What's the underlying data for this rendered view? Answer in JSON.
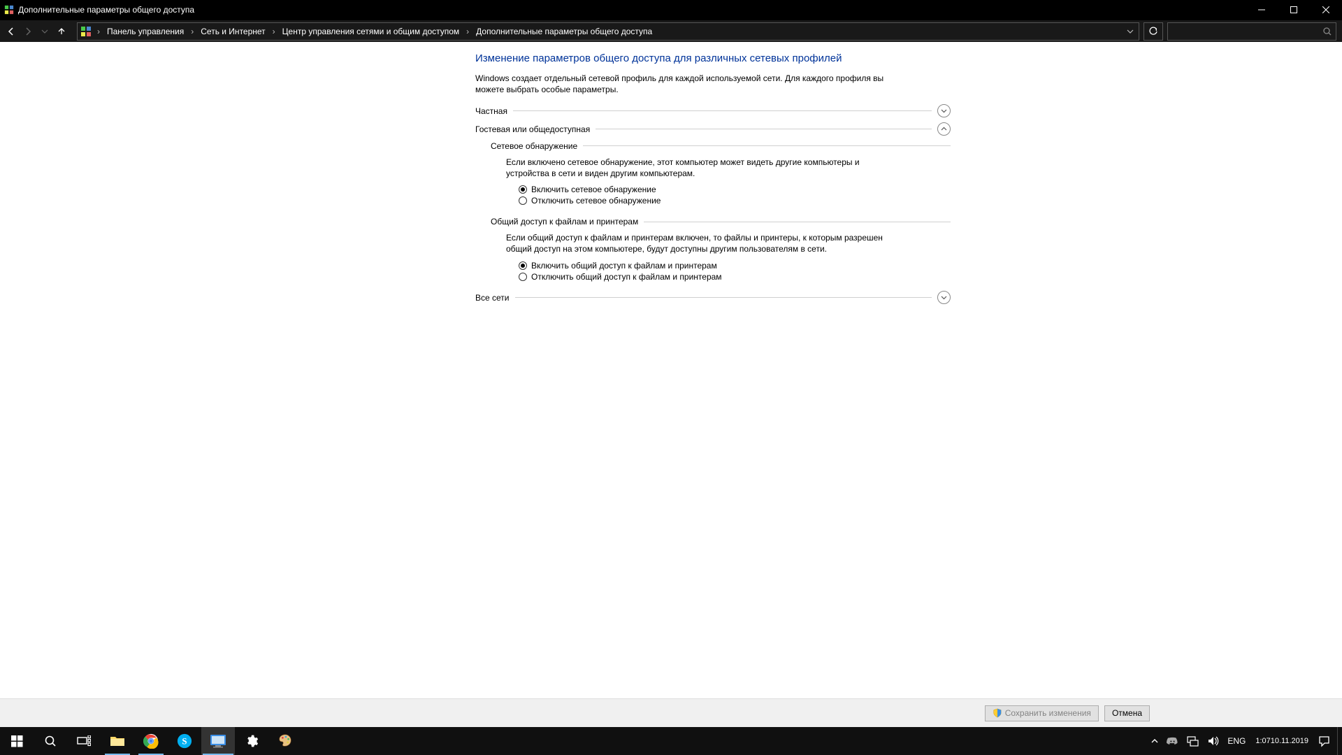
{
  "titlebar": {
    "title": "Дополнительные параметры общего доступа"
  },
  "nav": {
    "breadcrumbs": [
      "Панель управления",
      "Сеть и Интернет",
      "Центр управления сетями и общим доступом",
      "Дополнительные параметры общего доступа"
    ],
    "search_placeholder": ""
  },
  "content": {
    "heading": "Изменение параметров общего доступа для различных сетевых профилей",
    "description": "Windows создает отдельный сетевой профиль для каждой используемой сети. Для каждого профиля вы можете выбрать особые параметры.",
    "profiles": {
      "private": {
        "label": "Частная"
      },
      "guest": {
        "label": "Гостевая или общедоступная",
        "network_discovery": {
          "title": "Сетевое обнаружение",
          "desc": "Если включено сетевое обнаружение, этот компьютер может видеть другие компьютеры и устройства в сети и виден другим компьютерам.",
          "opt_on": "Включить сетевое обнаружение",
          "opt_off": "Отключить сетевое обнаружение"
        },
        "file_sharing": {
          "title": "Общий доступ к файлам и принтерам",
          "desc": "Если общий доступ к файлам и принтерам включен, то файлы и принтеры, к которым разрешен общий доступ на этом компьютере, будут доступны другим пользователям в сети.",
          "opt_on": "Включить общий доступ к файлам и принтерам",
          "opt_off": "Отключить общий доступ к файлам и принтерам"
        }
      },
      "all": {
        "label": "Все сети"
      }
    }
  },
  "footer": {
    "save": "Сохранить изменения",
    "cancel": "Отмена"
  },
  "taskbar": {
    "lang": "ENG",
    "time": "1:07",
    "date": "10.11.2019"
  }
}
